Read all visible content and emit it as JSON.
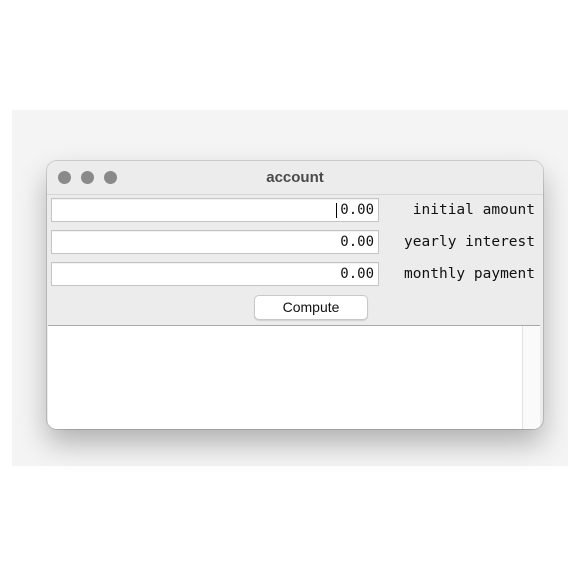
{
  "window": {
    "title": "account"
  },
  "form": {
    "fields": [
      {
        "value": "0.00",
        "label": "initial amount"
      },
      {
        "value": "0.00",
        "label": "yearly interest"
      },
      {
        "value": "0.00",
        "label": "monthly payment"
      }
    ],
    "compute_label": "Compute"
  },
  "output": {
    "text": ""
  },
  "colors": {
    "window_bg": "#ececec",
    "traffic_light": "#8a8a8a"
  }
}
